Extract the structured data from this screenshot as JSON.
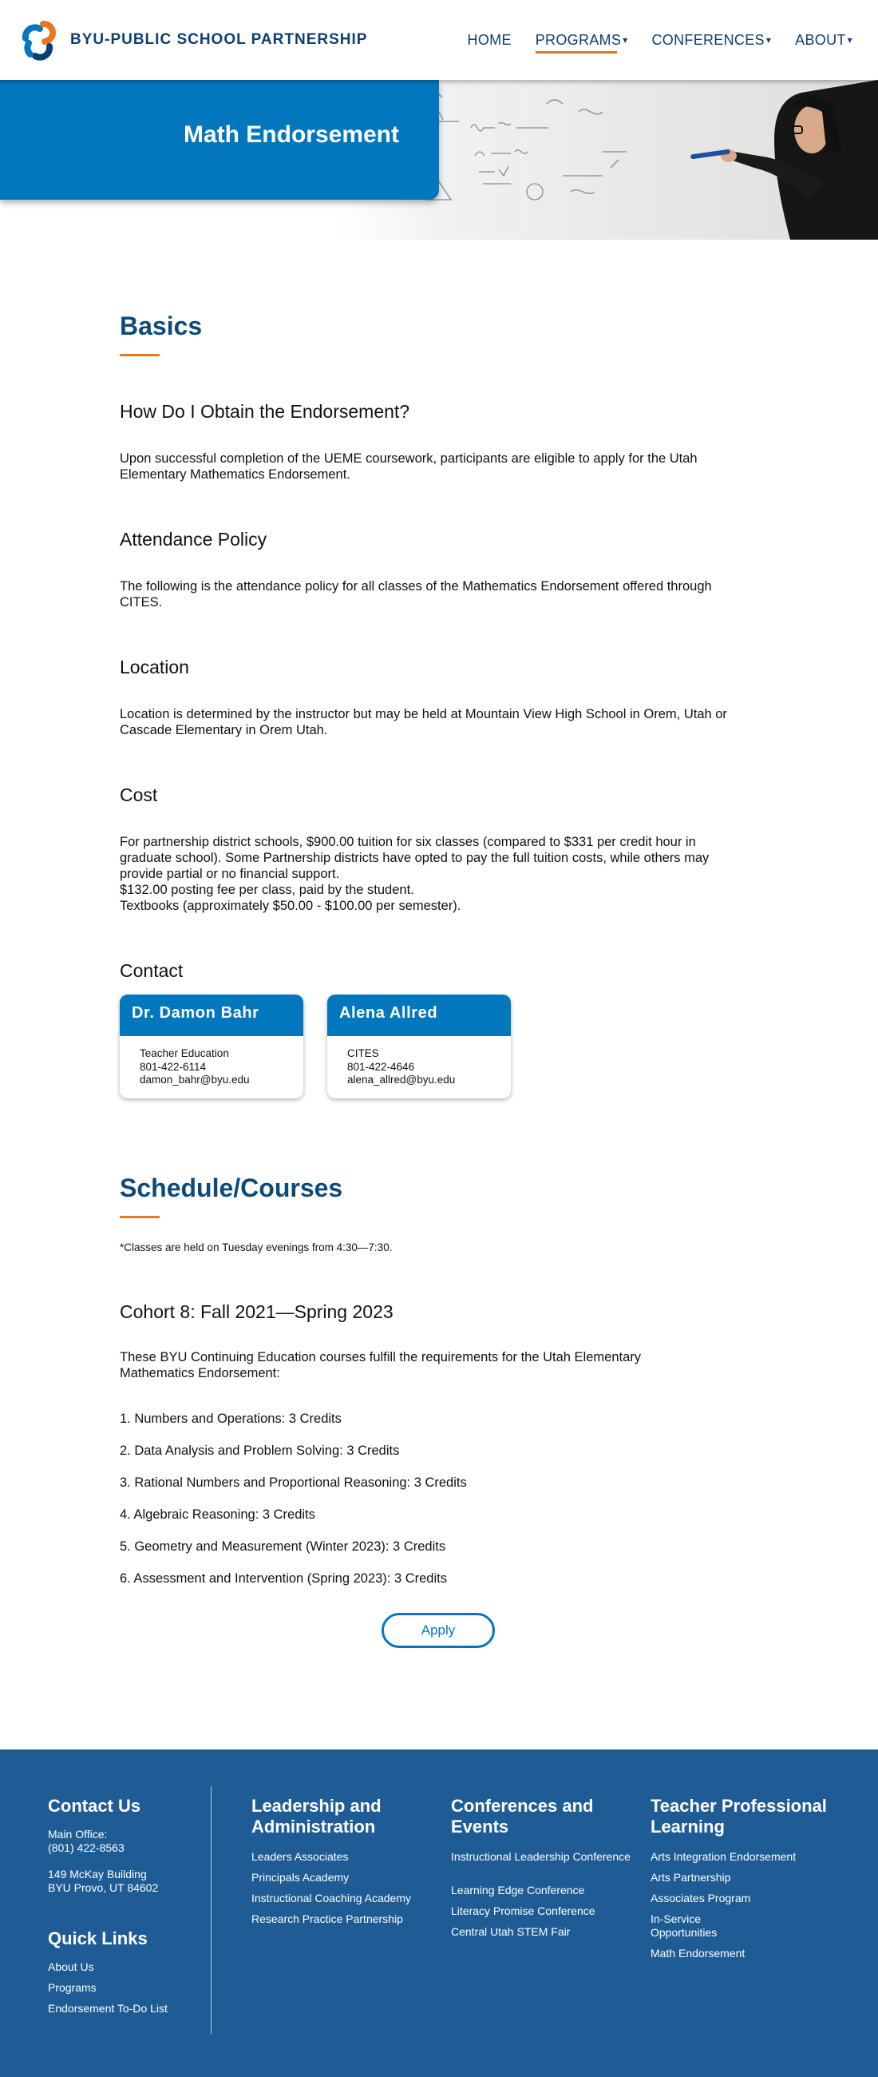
{
  "header": {
    "logo_text": "BYU-PUBLIC SCHOOL PARTNERSHIP",
    "nav": [
      {
        "label": "HOME",
        "caret": ""
      },
      {
        "label": "PROGRAMS",
        "caret": "▾"
      },
      {
        "label": "CONFERENCES",
        "caret": "▾"
      },
      {
        "label": "ABOUT",
        "caret": "▾"
      }
    ]
  },
  "hero": {
    "title": "Math Endorsement"
  },
  "basics": {
    "title": "Basics",
    "sections": [
      {
        "heading": "How Do I Obtain the Endorsement?",
        "body": "Upon successful completion of the UEME coursework, participants are eligible to apply for the Utah Elementary Mathematics Endorsement."
      },
      {
        "heading": "Attendance Policy",
        "body": "The following is the attendance policy for all classes of the Mathematics Endorsement offered through CITES."
      },
      {
        "heading": "Location",
        "body": "Location is determined by the instructor but may be held at Mountain View High School in Orem, Utah or Cascade Elementary in Orem Utah."
      },
      {
        "heading": "Cost",
        "body": "For partnership district schools, $900.00 tuition for six classes (compared to $331 per credit hour in graduate school). Some Partnership districts have opted to pay the full tuition costs, while others may provide partial or no financial support.",
        "line2": "$132.00 posting fee per class, paid by the student.",
        "line3": "Textbooks (approximately $50.00 - $100.00 per semester)."
      }
    ],
    "contact_heading": "Contact",
    "contacts": [
      {
        "name": "Dr. Damon Bahr",
        "dept": "Teacher Education",
        "phone": "801-422-6114",
        "email": "damon_bahr@byu.edu"
      },
      {
        "name": "Alena Allred",
        "dept": "CITES",
        "phone": "801-422-4646",
        "email": "alena_allred@byu.edu"
      }
    ]
  },
  "schedule": {
    "title": "Schedule/Courses",
    "note": "*Classes are held on Tuesday evenings from 4:30—7:30.",
    "cohort_heading": "Cohort 8: Fall 2021—Spring 2023",
    "intro": "These BYU Continuing Education courses fulfill the requirements for the Utah Elementary Mathematics Endorsement:",
    "courses": [
      "1. Numbers and Operations: 3 Credits",
      "2. Data Analysis and Problem Solving: 3 Credits",
      "3. Rational Numbers and Proportional Reasoning: 3 Credits",
      "4. Algebraic Reasoning: 3 Credits",
      "5. Geometry and Measurement (Winter 2023): 3 Credits",
      "6. Assessment and Intervention (Spring 2023): 3 Credits"
    ],
    "apply_label": "Apply"
  },
  "footer": {
    "contact": {
      "title": "Contact Us",
      "office_label": "Main Office:",
      "phone": "(801) 422-8563",
      "address1": "149 McKay Building",
      "address2": "BYU Provo, UT 84602"
    },
    "quick_links": {
      "title": "Quick Links",
      "links": [
        "About Us",
        "Programs",
        "Endorsement To-Do List"
      ]
    },
    "leadership": {
      "title_line1": "Leadership and",
      "title_line2": "Administration",
      "links": [
        "Leaders Associates",
        "Principals Academy",
        "Instructional Coaching Academy",
        "Research Practice Partnership"
      ]
    },
    "conferences": {
      "title_line1": "Conferences and",
      "title_line2": "Events",
      "links": [
        "Instructional Leadership Conference",
        "Learning Edge Conference",
        "Literacy Promise Conference",
        "Central Utah STEM Fair"
      ]
    },
    "teacher": {
      "title_line1": "Teacher Professional",
      "title_line2": "Learning",
      "links": [
        "Arts Integration Endorsement",
        "Arts Partnership",
        "Associates Program",
        "In-Service",
        "Opportunities",
        "Math Endorsement"
      ]
    }
  },
  "colors": {
    "brand_blue": "#0277bd",
    "navy": "#0d3e73",
    "accent_orange": "#e87722",
    "footer_blue": "#1f5c96"
  }
}
